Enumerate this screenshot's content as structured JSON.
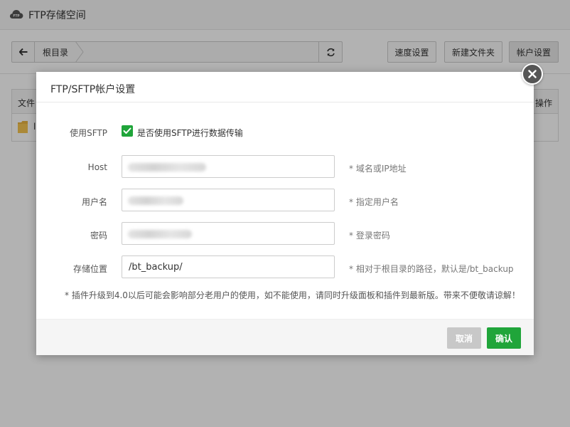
{
  "app": {
    "title": "FTP存储空间",
    "logo_text": "FTP"
  },
  "toolbar": {
    "breadcrumb": "根目录",
    "buttons": {
      "speed": "速度设置",
      "new_folder": "新建文件夹",
      "account": "帐户设置"
    }
  },
  "table": {
    "col_file": "文件",
    "col_op": "操作",
    "row_name": "li"
  },
  "modal": {
    "title": "FTP/SFTP帐户设置",
    "sftp": {
      "label": "使用SFTP",
      "checked": true,
      "text": "是否使用SFTP进行数据传输"
    },
    "host": {
      "label": "Host",
      "hint": "* 域名或IP地址"
    },
    "username": {
      "label": "用户名",
      "hint": "* 指定用户名"
    },
    "password": {
      "label": "密码",
      "hint": "* 登录密码"
    },
    "storage": {
      "label": "存储位置",
      "value": "/bt_backup/",
      "hint": "* 相对于根目录的路径，默认是/bt_backup"
    },
    "notice": "* 插件升级到4.0以后可能会影响部分老用户的使用，如不能使用，请同时升级面板和插件到最新版。带来不便敬请谅解！",
    "cancel_label": "取消",
    "confirm_label": "确认"
  },
  "colors": {
    "accent": "#20a53a",
    "cancel_bg": "#c8c8c8",
    "overlay": "rgba(0,0,0,0.3)"
  }
}
